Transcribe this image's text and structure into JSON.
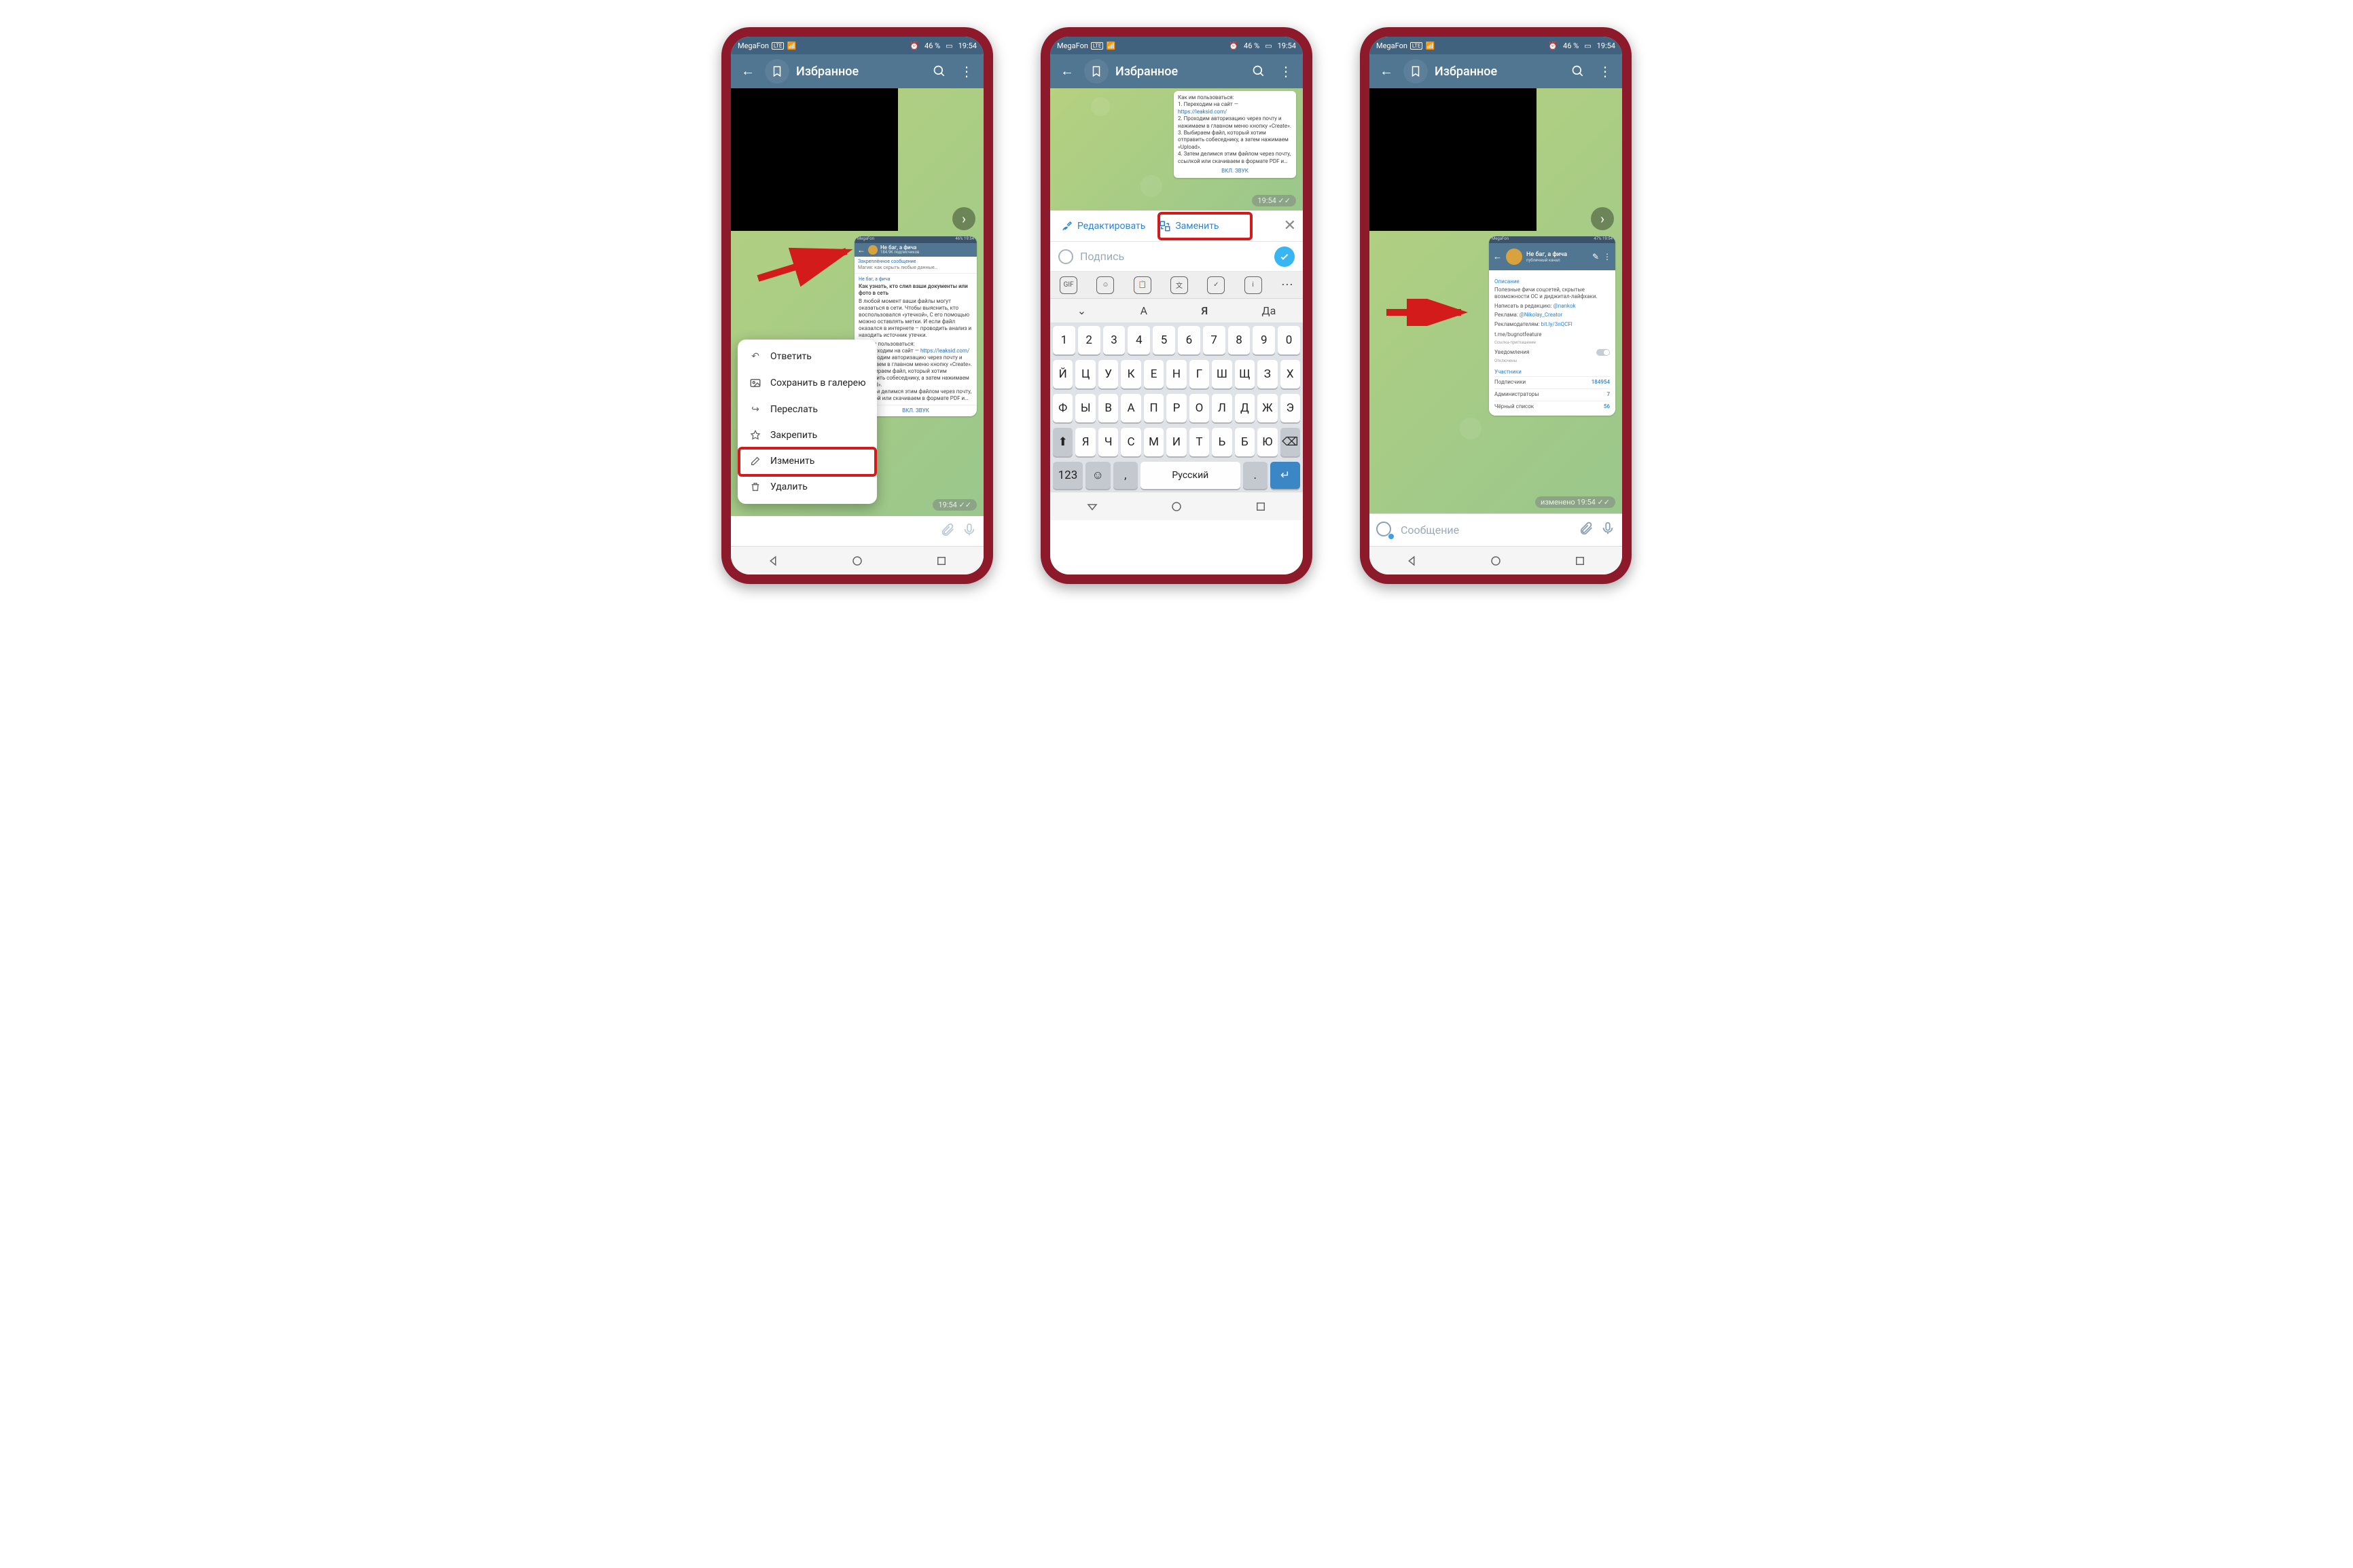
{
  "status": {
    "carrier": "MegaFon",
    "lte": "LTE",
    "battery": "46 %",
    "time": "19:54"
  },
  "header": {
    "title": "Избранное"
  },
  "ctx": {
    "reply": "Ответить",
    "save": "Сохранить в галерею",
    "forward": "Переслать",
    "pin": "Закрепить",
    "edit": "Изменить",
    "delete": "Удалить"
  },
  "editbar": {
    "edit": "Редактировать",
    "replace": "Заменить"
  },
  "caption": {
    "placeholder": "Подпись"
  },
  "suggest": {
    "a": "А",
    "b": "Я",
    "c": "Да"
  },
  "kb": {
    "nums": [
      "1",
      "2",
      "3",
      "4",
      "5",
      "6",
      "7",
      "8",
      "9",
      "0"
    ],
    "r1": [
      "Й",
      "Ц",
      "У",
      "К",
      "Е",
      "Н",
      "Г",
      "Ш",
      "Щ",
      "З",
      "Х"
    ],
    "r2": [
      "Ф",
      "Ы",
      "В",
      "А",
      "П",
      "Р",
      "О",
      "Л",
      "Д",
      "Ж",
      "Э"
    ],
    "r3": [
      "Я",
      "Ч",
      "С",
      "М",
      "И",
      "Т",
      "Ь",
      "Б",
      "Ю"
    ],
    "shift": "⬆",
    "bksp": "⌫",
    "space": "Русский",
    "n123": "123"
  },
  "input": {
    "placeholder": "Сообщение"
  },
  "msg_time": "19:54",
  "edited": "изменено 19:54",
  "mini": {
    "chan": "Не баг, а фича",
    "subs": "184.9K подписчиков",
    "pinned": "Закреплённое сообщение",
    "pinned_sub": "Магия: как скрыть любые данные…",
    "fwd": "Не баг, а фича",
    "title": "Как узнать, кто слил ваши документы или фото в сеть",
    "body1": "В любой момент ваши файлы могут оказаться в сети. Чтобы выяснить, кто воспользовался «утечкой», С его помощью можно оставлять метки. И если файл оказался в интернете – проводить анализ и находить источник утечки.",
    "use": "Как им пользоваться:",
    "l1": "1. Переходим на сайт —",
    "l1u": "https://leaksid.com/",
    "l2": "2. Проходим авторизацию через почту и нажимаем в главном меню кнопку «Create».",
    "l3": "3. Выбираем файл, который хотим отправить собеседнику, а затем нажимаем «Upload».",
    "l4": "4. Затем делимся этим файлом через почту, ссылкой или скачиваем в формате PDF и…",
    "sound": "ВКЛ. ЗВУК"
  },
  "profile": {
    "name": "Не баг, а фича",
    "type": "публичный канал",
    "desc_h": "Описание",
    "desc": "Полезные фичи соцсетей, скрытые возможности ОС и диджитал-лайфхаки.",
    "contact_l": "Написать в редакцию:",
    "contact": "@nankok",
    "ad_l": "Реклама:",
    "ad": "@Nikolay_Creator",
    "adv_l": "Рекламодателям:",
    "adv": "bit.ly/3nQCFl",
    "link": "t.me/bugnotfeature",
    "link_sub": "Ссылка-приглашение",
    "notif": "Уведомления",
    "notif_s": "Отключены",
    "members": "Участники",
    "subs_l": "Подписчики",
    "subs_v": "184954",
    "adm_l": "Администраторы",
    "adm_v": "7",
    "bl_l": "Чёрный список",
    "bl_v": "56"
  }
}
